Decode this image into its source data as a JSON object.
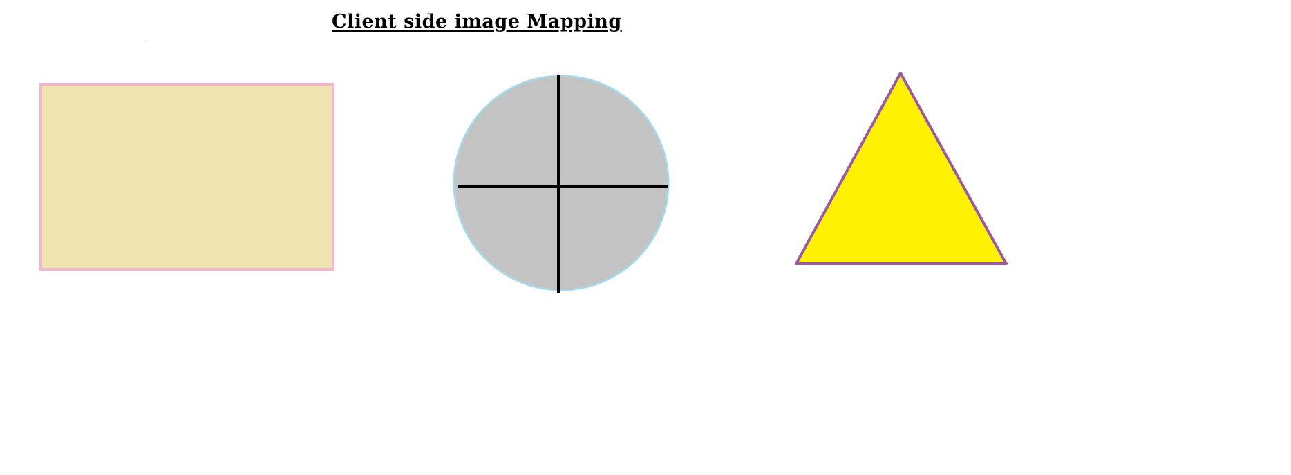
{
  "page": {
    "title": "Client side image Mapping"
  },
  "image_map": {
    "areas": [
      {
        "shape": "rect",
        "fill": "#efe3b0",
        "stroke": "#f3b5cc"
      },
      {
        "shape": "circle",
        "fill": "#c3c3c3",
        "stroke": "#a8d8e6",
        "crosshair_color": "#000000"
      },
      {
        "shape": "triangle",
        "fill": "#fff200",
        "stroke": "#9b59a0"
      }
    ]
  }
}
